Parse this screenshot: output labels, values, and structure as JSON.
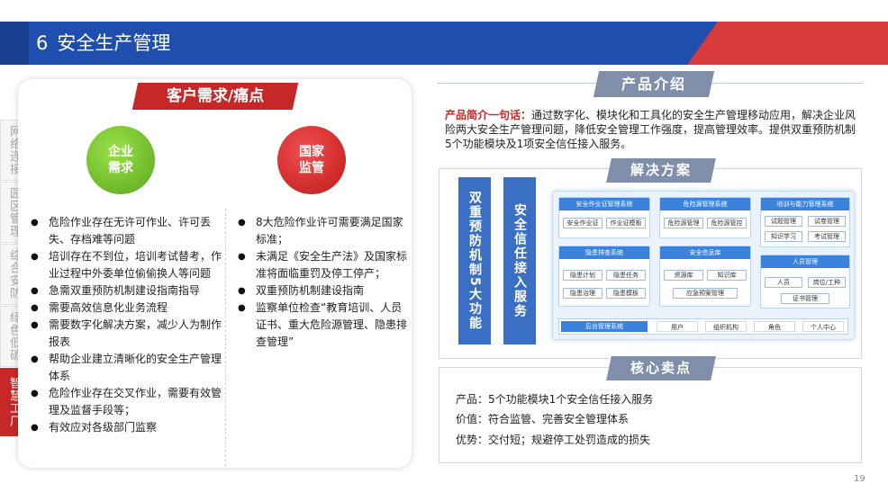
{
  "header": {
    "section_number": "6",
    "title": "安全生产管理"
  },
  "side_tabs": [
    {
      "label": "网络连接",
      "active": false
    },
    {
      "label": "园区管理",
      "active": false
    },
    {
      "label": "综合安防",
      "active": false
    },
    {
      "label": "绿色低碳",
      "active": false
    },
    {
      "label": "智慧工厂",
      "active": true
    }
  ],
  "needs": {
    "banner": "客户需求/痛点",
    "enterprise_circle": "企业需求",
    "state_circle": "国家监管",
    "enterprise_items": [
      "危险作业存在无许可作业、许可丢失、存档难等问题",
      "培训存在不到位，培训考试替考，作业过程中外委单位偷偷换人等问题",
      "急需双重预防机制建设指南指导",
      "需要高效信息化业务流程",
      "需要数字化解决方案，减少人为制作报表",
      "帮助企业建立清晰化的安全生产管理体系",
      "危险作业存在交叉作业，需要有效管理及监督手段等；",
      "有效应对各级部门监察"
    ],
    "state_items": [
      "8大危险作业许可需要满足国家标准；",
      "未满足《安全生产法》及国家标准将面临重罚及停工停产；",
      "双重预防机制建设指南",
      "监察单位检查“教育培训、人员证书、重大危险源管理、隐患排查管理”"
    ]
  },
  "product": {
    "tag": "产品介绍",
    "intro_lead": "产品简介一句话：",
    "intro_text": "通过数字化、模块化和工具化的安全生产管理移动应用，解决企业风险两大安全生产管理问题，降低安全管理工作强度，提高管理效率。提供双重预防机制5个功能模块及1项安全信任接入服务。"
  },
  "solution": {
    "tag": "解决方案",
    "bar_one": "双重预防机制5大功能",
    "bar_two": "安全信任接入服务",
    "modules": [
      {
        "title": "安全作业证管理系统",
        "chips": [
          "安全作业证",
          "作业证模板"
        ]
      },
      {
        "title": "危险源管理系统",
        "chips": [
          "危险源管理",
          "危险源管控"
        ]
      },
      {
        "title": "培训与能力管理系统",
        "chips": [
          "试题管理",
          "试卷管理",
          "知识学习",
          "考试管理"
        ]
      },
      {
        "title": "隐患排查系统",
        "chips": [
          "隐患计划",
          "隐患任务",
          "隐患治理",
          "隐患模板"
        ]
      },
      {
        "title": "安全信息库",
        "chips": [
          "资源库",
          "知识库",
          "应急预案管理"
        ]
      },
      {
        "title": "人员管理",
        "chips": [
          "人员",
          "岗位/工种",
          "证书管理"
        ]
      }
    ],
    "bottom": {
      "title": "后台管理系统",
      "items": [
        "用户",
        "组织机构",
        "角色",
        "个人中心"
      ]
    }
  },
  "core": {
    "tag": "核心卖点",
    "lines": [
      "产品：5个功能模块1个安全信任接入服务",
      "价值：符合监管、完善安全管理体系",
      "优势：交付短；规避停工处罚造成的损失"
    ]
  },
  "page_number": "19",
  "colors": {
    "header_blue": "#1f4fae",
    "accent_red": "#c62828",
    "tag_gray": "#7f8faa",
    "module_blue": "#3b82dc",
    "bar_blue": "#3b6fc4",
    "circle_green": "#5aa81c"
  }
}
